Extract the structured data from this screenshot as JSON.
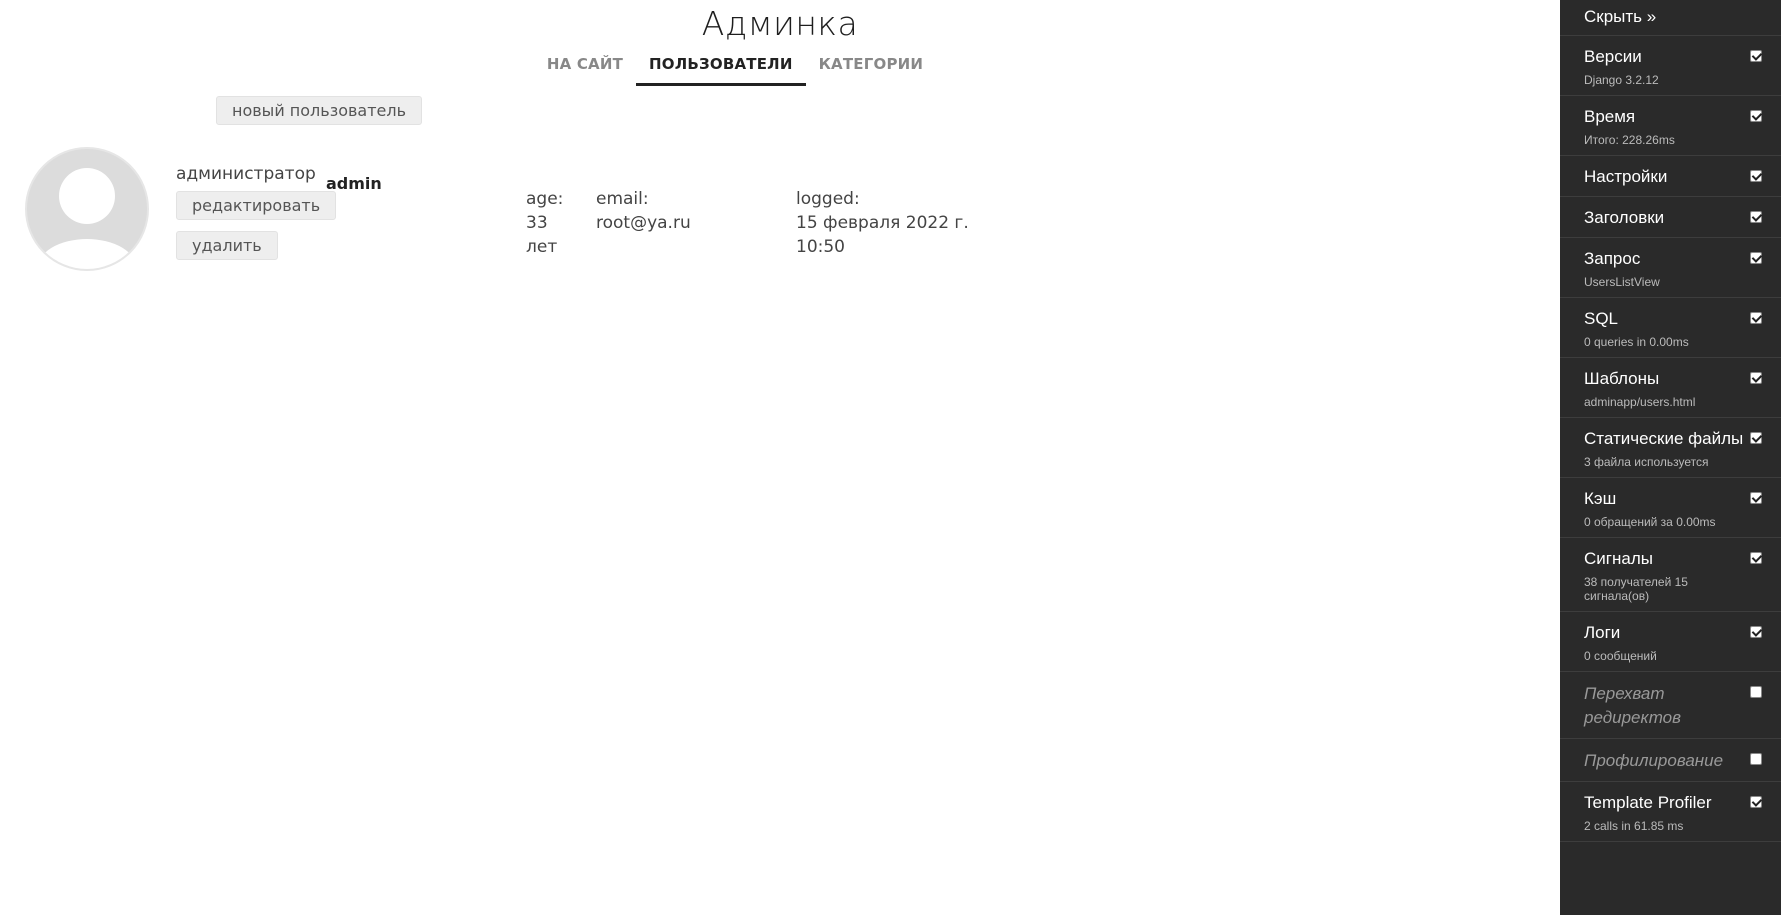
{
  "header": {
    "title": "Админка"
  },
  "nav": {
    "items": [
      {
        "label": "НА САЙТ",
        "active": false
      },
      {
        "label": "ПОЛЬЗОВАТЕЛИ",
        "active": true
      },
      {
        "label": "КАТЕГОРИИ",
        "active": false
      }
    ]
  },
  "actions": {
    "new_user": "новый пользователь"
  },
  "user": {
    "role": "администратор",
    "username": "admin",
    "edit_label": "редактировать",
    "delete_label": "удалить",
    "age_label": "age:",
    "age_value": "33",
    "age_unit": "лет",
    "email_label": "email:",
    "email_value": "root@ya.ru",
    "logged_label": "logged:",
    "logged_date": "15 февраля 2022 г.",
    "logged_time": "10:50"
  },
  "debug_toolbar": {
    "hide_label": "Скрыть »",
    "panels": [
      {
        "title": "Версии",
        "subtitle": "Django 3.2.12",
        "enabled": true
      },
      {
        "title": "Время",
        "subtitle": "Итого: 228.26ms",
        "enabled": true
      },
      {
        "title": "Настройки",
        "subtitle": "",
        "enabled": true
      },
      {
        "title": "Заголовки",
        "subtitle": "",
        "enabled": true
      },
      {
        "title": "Запрос",
        "subtitle": "UsersListView",
        "enabled": true
      },
      {
        "title": "SQL",
        "subtitle": "0 queries in 0.00ms",
        "enabled": true
      },
      {
        "title": "Шаблоны",
        "subtitle": "adminapp/users.html",
        "enabled": true
      },
      {
        "title": "Статические файлы",
        "subtitle": "3 файла используется",
        "enabled": true
      },
      {
        "title": "Кэш",
        "subtitle": "0 обращений за 0.00ms",
        "enabled": true
      },
      {
        "title": "Сигналы",
        "subtitle": "38 получателей 15 сигнала(ов)",
        "enabled": true
      },
      {
        "title": "Логи",
        "subtitle": "0 сообщений",
        "enabled": true
      },
      {
        "title": "Перехват редиректов",
        "subtitle": "",
        "enabled": false
      },
      {
        "title": "Профилирование",
        "subtitle": "",
        "enabled": false
      },
      {
        "title": "Template Profiler",
        "subtitle": "2 calls in 61.85 ms",
        "enabled": true
      }
    ]
  }
}
